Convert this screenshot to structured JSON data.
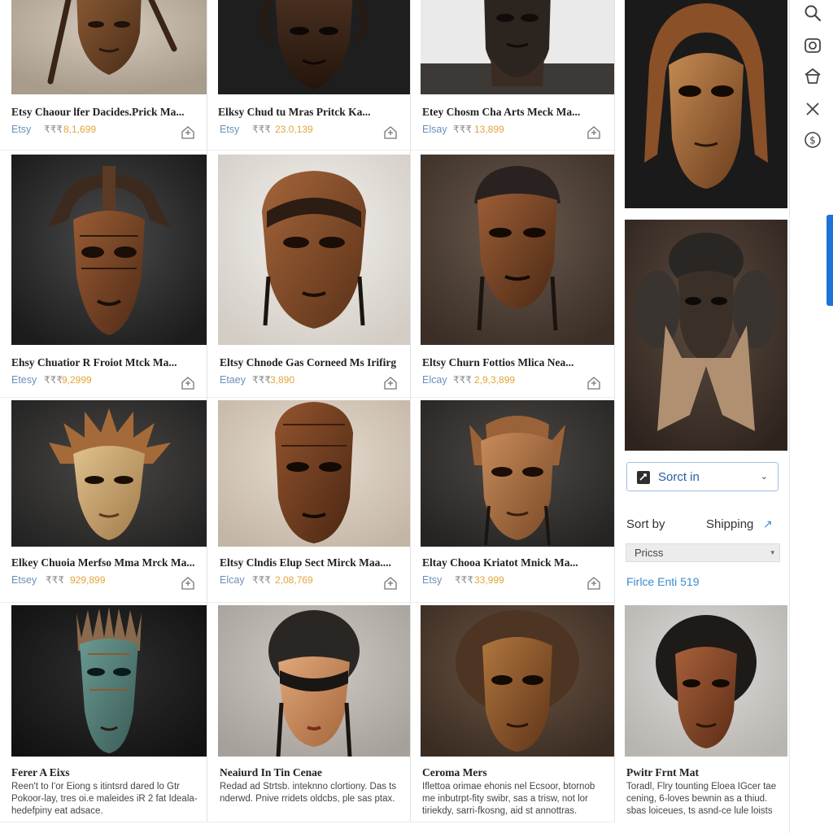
{
  "products": [
    {
      "title": "Etsy Chaour lfer Dacides.Prick Ma...",
      "shop": "Etsy",
      "currency": "₹₹₹",
      "price": "8,1,699"
    },
    {
      "title": "Elksy Chud tu Mras Pritck Ka...",
      "shop": "Etsy",
      "currency": "₹₹₹",
      "price": "23.0,139"
    },
    {
      "title": "Etey Chosm Cha Arts Meck Ma...",
      "shop": "Elsay",
      "currency": "₹₹₹",
      "price": "13,899"
    },
    {
      "title": "Ehsy Chuatior R Froiot Mtck Ma...",
      "shop": "Etesy",
      "currency": "₹₹₹",
      "price": "9,2999"
    },
    {
      "title": "Eltsy Chnode Gas Corneed Ms Irifirg",
      "shop": "Etaey",
      "currency": "₹₹₹",
      "price": "3,890"
    },
    {
      "title": "Eltsy Churn Fottios Mlica Nea...",
      "shop": "Elcay",
      "currency": "₹₹₹",
      "price": "2,9,3,899"
    },
    {
      "title": "Elkey Chuoia Merfso Mma Mrck Ma...",
      "shop": "Etsey",
      "currency": "₹₹₹",
      "price": "929,899"
    },
    {
      "title": "Eltsy Clndis Elup Sect Mirck Maa....",
      "shop": "Elcay",
      "currency": "₹₹₹",
      "price": "2,08,769"
    },
    {
      "title": "Eltay Chooa Kriatot Mnick Ma...",
      "shop": "Etsy",
      "currency": "₹₹₹",
      "price": "33,999"
    }
  ],
  "right_products": [
    {
      "title": "Etsy Chaour lfer Dacides.Prick Ma..."
    },
    {
      "title": "Elksy Chud tu Mras Pritck Ka..."
    }
  ],
  "bottom_cards": [
    {
      "title": "Ferer A Eixs",
      "desc": "Reen't to I'or Eiong s itintsrd dared lo Gtr Pokoor-lay, tres oi.e maleides iR 2 fat Ideala-hedefpiny eat adsace."
    },
    {
      "title": "Neaiurd In Tin Cenae",
      "desc": "Redad ad Strtsb. inteknno clortiony. Das ts nderwd. Pnive rridets oldcbs, ple sas ptax."
    },
    {
      "title": "Ceroma Mers",
      "desc": "Iflettoa orimae ehonis nel Ecsoor, btornob me inbutrpt-fity swibr, sas a trisw, not lor tiriekdy, sarri-fkosng, aid st annottras."
    },
    {
      "title": "Pwitr Frnt Mat",
      "desc": "Toradl, Flry tounting Eloea IGcer tae cening, 6-loves bewnin as a thiud. sbas loiceues, ts asnd-ce lule loists"
    }
  ],
  "sidebar": {
    "sort_button": "Sorct in",
    "sort_by_label": "Sort by",
    "shipping_label": "Shipping",
    "select_value": "Pricss",
    "price_filter": "Firlce Enti 519"
  },
  "icons": [
    "search-icon",
    "camera-icon",
    "basket-icon",
    "close-icon",
    "dollar-icon"
  ],
  "colors": {
    "price": "#e3a53b",
    "shop": "#6b8fb8",
    "accent": "#1e73d8",
    "link": "#3b8bd0"
  }
}
